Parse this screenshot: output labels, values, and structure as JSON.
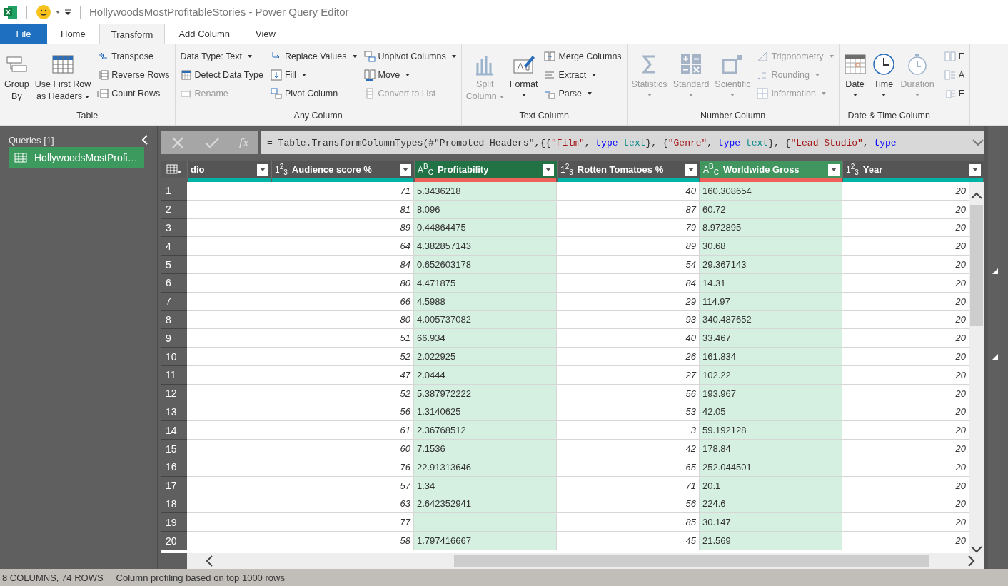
{
  "title_bar": {
    "title": "HollywoodsMostProfitableStories - Power Query Editor"
  },
  "tabs": [
    {
      "label": "File",
      "kind": "file",
      "selected": false
    },
    {
      "label": "Home",
      "kind": "tab",
      "selected": false
    },
    {
      "label": "Transform",
      "kind": "tab",
      "selected": true
    },
    {
      "label": "Add Column",
      "kind": "tab",
      "selected": false
    },
    {
      "label": "View",
      "kind": "tab",
      "selected": false
    }
  ],
  "ribbon": [
    {
      "label": "Table",
      "large": [
        {
          "lines": [
            "Group",
            "By"
          ],
          "dropdown": false,
          "disabled": false
        },
        {
          "lines": [
            "Use First Row",
            "as Headers"
          ],
          "dropdown": true,
          "disabled": false
        }
      ],
      "columns": [
        [
          {
            "label": "Transpose",
            "dropdown": false,
            "disabled": false
          },
          {
            "label": "Reverse Rows",
            "dropdown": false,
            "disabled": false
          },
          {
            "label": "Count Rows",
            "dropdown": false,
            "disabled": false
          }
        ]
      ]
    },
    {
      "label": "Any Column",
      "columns": [
        [
          {
            "label": "Data Type: Text",
            "dropdown": true,
            "disabled": false
          },
          {
            "label": "Detect Data Type",
            "dropdown": false,
            "disabled": false
          },
          {
            "label": "Rename",
            "dropdown": false,
            "disabled": true
          }
        ],
        [
          {
            "label": "Replace Values",
            "dropdown": true,
            "disabled": false
          },
          {
            "label": "Fill",
            "dropdown": true,
            "disabled": false
          },
          {
            "label": "Pivot Column",
            "dropdown": false,
            "disabled": false
          }
        ],
        [
          {
            "label": "Unpivot Columns",
            "dropdown": true,
            "disabled": false
          },
          {
            "label": "Move",
            "dropdown": true,
            "disabled": false
          },
          {
            "label": "Convert to List",
            "dropdown": false,
            "disabled": true
          }
        ]
      ]
    },
    {
      "label": "Text Column",
      "large": [
        {
          "lines": [
            "Split",
            "Column"
          ],
          "dropdown": true,
          "disabled": true
        },
        {
          "lines": [
            "Format"
          ],
          "dropdown": true,
          "disabled": false
        }
      ],
      "columns": [
        [
          {
            "label": "Merge Columns",
            "dropdown": false,
            "disabled": false
          },
          {
            "label": "Extract",
            "dropdown": true,
            "disabled": false
          },
          {
            "label": "Parse",
            "dropdown": true,
            "disabled": false
          }
        ]
      ]
    },
    {
      "label": "Number Column",
      "large": [
        {
          "lines": [
            "Statistics"
          ],
          "dropdown": true,
          "disabled": true
        },
        {
          "lines": [
            "Standard"
          ],
          "dropdown": true,
          "disabled": true
        },
        {
          "lines": [
            "Scientific"
          ],
          "dropdown": true,
          "disabled": true
        }
      ],
      "columns": [
        [
          {
            "label": "Trigonometry",
            "dropdown": true,
            "disabled": true
          },
          {
            "label": "Rounding",
            "dropdown": true,
            "disabled": true
          },
          {
            "label": "Information",
            "dropdown": true,
            "disabled": true
          }
        ]
      ]
    },
    {
      "label": "Date & Time Column",
      "large": [
        {
          "lines": [
            "Date"
          ],
          "dropdown": true,
          "disabled": false
        },
        {
          "lines": [
            "Time"
          ],
          "dropdown": true,
          "disabled": false
        },
        {
          "lines": [
            "Duration"
          ],
          "dropdown": true,
          "disabled": true
        }
      ]
    },
    {
      "columns": [
        [
          {
            "label": "E",
            "dropdown": false,
            "disabled": false
          },
          {
            "label": "A",
            "dropdown": false,
            "disabled": false
          },
          {
            "label": "E",
            "dropdown": false,
            "disabled": false
          }
        ]
      ]
    }
  ],
  "queries": {
    "heading": "Queries [1]",
    "items": [
      {
        "label": "HollywoodsMostProfi…",
        "selected": true
      }
    ]
  },
  "formula_bar": {
    "fx": "fx",
    "tokens": [
      {
        "text": "= Table.TransformColumnTypes(#\"Promoted Headers\",{{",
        "kind": "plain"
      },
      {
        "text": "\"Film\"",
        "kind": "string"
      },
      {
        "text": ", ",
        "kind": "plain"
      },
      {
        "text": "type",
        "kind": "keyword"
      },
      {
        "text": " text",
        "kind": "type"
      },
      {
        "text": "}, {",
        "kind": "plain"
      },
      {
        "text": "\"Genre\"",
        "kind": "string"
      },
      {
        "text": ", ",
        "kind": "plain"
      },
      {
        "text": "type",
        "kind": "keyword"
      },
      {
        "text": " text",
        "kind": "type"
      },
      {
        "text": "}, {",
        "kind": "plain"
      },
      {
        "text": "\"Lead Studio\"",
        "kind": "string"
      },
      {
        "text": ", ",
        "kind": "plain"
      },
      {
        "text": "type",
        "kind": "keyword"
      }
    ]
  },
  "table": {
    "columns": [
      {
        "label": "dio",
        "kind": "text",
        "color": "#00b3a4",
        "selected": false
      },
      {
        "label": "Audience score %",
        "type_icon": "1$^{2}$$_{3}$",
        "kind": "number",
        "color": "#00b3a4",
        "selected": false
      },
      {
        "label": "Profitability",
        "type_icon": "A$^{B}$$_{C}$",
        "kind": "text",
        "color": "#f0605a",
        "selected": true,
        "focused": true
      },
      {
        "label": "Rotten Tomatoes %",
        "type_icon": "1$^{2}$$_{3}$",
        "kind": "number",
        "color": "#00b3a4",
        "selected": false
      },
      {
        "label": "Worldwide Gross",
        "type_icon": "A$^{B}$$_{C}$",
        "kind": "text",
        "color": "#f0605a",
        "selected": true,
        "focused": false
      },
      {
        "label": "Year",
        "type_icon": "1$^{2}$$_{3}$",
        "kind": "number",
        "color": "#00b3a4",
        "selected": false
      }
    ],
    "rows": [
      {
        "n": "1",
        "cells": [
          null,
          "71",
          "5.3436218",
          "40",
          "160.308654",
          "20"
        ]
      },
      {
        "n": "2",
        "cells": [
          null,
          "81",
          "8.096",
          "87",
          "60.72",
          "20"
        ]
      },
      {
        "n": "3",
        "cells": [
          null,
          "89",
          "0.44864475",
          "79",
          "8.972895",
          "20"
        ]
      },
      {
        "n": "4",
        "cells": [
          null,
          "64",
          "4.382857143",
          "89",
          "30.68",
          "20"
        ]
      },
      {
        "n": "5",
        "cells": [
          null,
          "84",
          "0.652603178",
          "54",
          "29.367143",
          "20"
        ]
      },
      {
        "n": "6",
        "cells": [
          null,
          "80",
          "4.471875",
          "84",
          "14.31",
          "20"
        ]
      },
      {
        "n": "7",
        "cells": [
          null,
          "66",
          "4.5988",
          "29",
          "114.97",
          "20"
        ]
      },
      {
        "n": "8",
        "cells": [
          null,
          "80",
          "4.005737082",
          "93",
          "340.487652",
          "20"
        ]
      },
      {
        "n": "9",
        "cells": [
          null,
          "51",
          "66.934",
          "40",
          "33.467",
          "20"
        ]
      },
      {
        "n": "10",
        "cells": [
          null,
          "52",
          "2.022925",
          "26",
          "161.834",
          "20"
        ]
      },
      {
        "n": "11",
        "cells": [
          null,
          "47",
          "2.0444",
          "27",
          "102.22",
          "20"
        ]
      },
      {
        "n": "12",
        "cells": [
          null,
          "52",
          "5.387972222",
          "56",
          "193.967",
          "20"
        ]
      },
      {
        "n": "13",
        "cells": [
          null,
          "56",
          "1.3140625",
          "53",
          "42.05",
          "20"
        ]
      },
      {
        "n": "14",
        "cells": [
          null,
          "61",
          "2.36768512",
          "3",
          "59.192128",
          "20"
        ]
      },
      {
        "n": "15",
        "cells": [
          null,
          "60",
          "7.1536",
          "42",
          "178.84",
          "20"
        ]
      },
      {
        "n": "16",
        "cells": [
          null,
          "76",
          "22.91313646",
          "65",
          "252.044501",
          "20"
        ]
      },
      {
        "n": "17",
        "cells": [
          null,
          "57",
          "1.34",
          "71",
          "20.1",
          "20"
        ]
      },
      {
        "n": "18",
        "cells": [
          null,
          "63",
          "2.642352941",
          "56",
          "224.6",
          "20"
        ]
      },
      {
        "n": "19",
        "cells": [
          null,
          "77",
          null,
          "85",
          "30.147",
          "20"
        ]
      },
      {
        "n": "20",
        "cells": [
          null,
          "58",
          "1.797416667",
          "45",
          "21.569",
          "20"
        ]
      }
    ]
  },
  "status_bar": [
    "8 COLUMNS, 74 ROWS",
    "Column profiling based on top 1000 rows"
  ]
}
